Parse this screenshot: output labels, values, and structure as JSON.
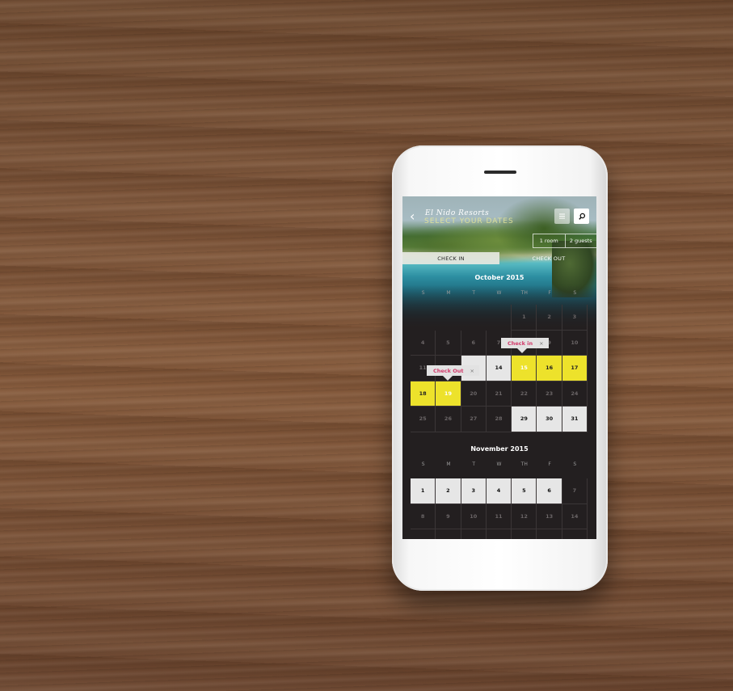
{
  "app": {
    "brand": "El Nido Resorts",
    "subtitle": "SELECT YOUR DATES",
    "room_label": "1 room",
    "guests_label": "2 guests",
    "check_in_tab": "CHECK IN",
    "check_out_tab": "CHECK OUT"
  },
  "tooltips": {
    "check_in": "Check in",
    "check_out": "Check Out",
    "close_glyph": "×"
  },
  "weekdays": [
    "S",
    "M",
    "T",
    "W",
    "TH",
    "F",
    "S"
  ],
  "calendar": {
    "october": {
      "title": "October 2015",
      "selected_range": [
        15,
        19
      ],
      "available": [
        13,
        14,
        29,
        30,
        31
      ],
      "rows": [
        [
          "",
          "",
          "",
          "",
          "1",
          "2",
          "3"
        ],
        [
          "4",
          "5",
          "6",
          "7",
          "8",
          "9",
          "10"
        ],
        [
          "11",
          "12",
          "13",
          "14",
          "15",
          "16",
          "17"
        ],
        [
          "18",
          "19",
          "20",
          "21",
          "22",
          "23",
          "24"
        ],
        [
          "25",
          "26",
          "27",
          "28",
          "29",
          "30",
          "31"
        ]
      ]
    },
    "november": {
      "title": "November 2015",
      "available": [
        1,
        2,
        3,
        4,
        5,
        6
      ],
      "rows": [
        [
          "1",
          "2",
          "3",
          "4",
          "5",
          "6",
          "7"
        ],
        [
          "8",
          "9",
          "10",
          "11",
          "12",
          "13",
          "14"
        ],
        [
          "",
          "",
          "",
          "",
          "",
          "",
          ""
        ]
      ]
    }
  },
  "colors": {
    "selected": "#ede22b",
    "available": "#e6e6e6",
    "screen_bg": "#231f20",
    "tooltip_text": "#d23a6a"
  }
}
